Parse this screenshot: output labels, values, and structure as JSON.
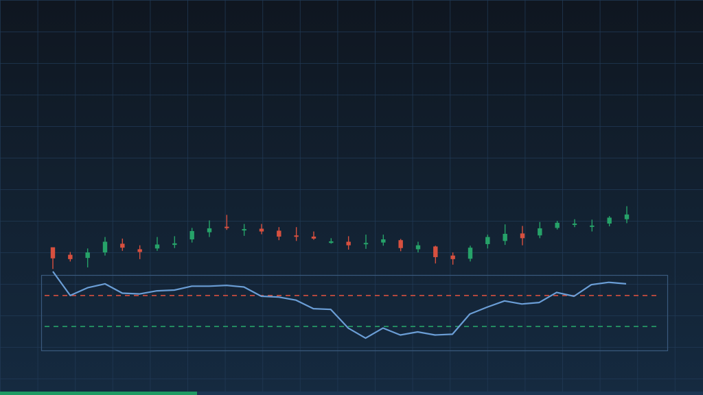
{
  "chart_data": [
    {
      "type": "candlestick",
      "grid": true,
      "up_color": "#26a269",
      "down_color": "#d7503f",
      "ylim": [
        0,
        100
      ],
      "candles": [
        {
          "open": 37.4,
          "close": 34.6,
          "high": 36.1,
          "low": 31.9
        },
        {
          "open": 35.5,
          "close": 34.4,
          "high": 36.2,
          "low": 33.8
        },
        {
          "open": 34.7,
          "close": 36.1,
          "high": 37.1,
          "low": 32.3
        },
        {
          "open": 36.1,
          "close": 38.8,
          "high": 40.0,
          "low": 35.3
        },
        {
          "open": 38.3,
          "close": 37.3,
          "high": 39.6,
          "low": 36.5
        },
        {
          "open": 36.9,
          "close": 36.2,
          "high": 37.9,
          "low": 34.4
        },
        {
          "open": 37.1,
          "close": 38.1,
          "high": 40.0,
          "low": 36.5
        },
        {
          "open": 38.0,
          "close": 38.4,
          "high": 40.2,
          "low": 37.2
        },
        {
          "open": 39.4,
          "close": 41.5,
          "high": 42.3,
          "low": 38.6
        },
        {
          "open": 41.2,
          "close": 42.2,
          "high": 44.2,
          "low": 40.0
        },
        {
          "open": 42.6,
          "close": 42.5,
          "high": 45.6,
          "low": 41.8
        },
        {
          "open": 42.0,
          "close": 42.0,
          "high": 43.3,
          "low": 40.3
        },
        {
          "open": 42.1,
          "close": 41.4,
          "high": 43.3,
          "low": 40.7
        },
        {
          "open": 41.6,
          "close": 40.1,
          "high": 42.5,
          "low": 39.2
        },
        {
          "open": 40.4,
          "close": 40.2,
          "high": 42.5,
          "low": 39.0
        },
        {
          "open": 40.1,
          "close": 39.6,
          "high": 41.4,
          "low": 39.3
        },
        {
          "open": 38.5,
          "close": 38.9,
          "high": 39.7,
          "low": 38.3
        },
        {
          "open": 38.8,
          "close": 37.9,
          "high": 40.2,
          "low": 36.8
        },
        {
          "open": 38.2,
          "close": 38.5,
          "high": 40.6,
          "low": 37.0
        },
        {
          "open": 38.6,
          "close": 39.4,
          "high": 40.6,
          "low": 37.8
        },
        {
          "open": 39.2,
          "close": 37.2,
          "high": 39.5,
          "low": 36.4
        },
        {
          "open": 36.9,
          "close": 37.9,
          "high": 38.8,
          "low": 36.1
        },
        {
          "open": 37.6,
          "close": 34.9,
          "high": 37.8,
          "low": 33.3
        },
        {
          "open": 35.3,
          "close": 34.4,
          "high": 36.1,
          "low": 33.0
        },
        {
          "open": 34.5,
          "close": 37.3,
          "high": 37.8,
          "low": 33.8
        },
        {
          "open": 38.2,
          "close": 40.0,
          "high": 40.6,
          "low": 37.1
        },
        {
          "open": 39.0,
          "close": 40.8,
          "high": 43.2,
          "low": 38.0
        },
        {
          "open": 40.9,
          "close": 39.7,
          "high": 42.8,
          "low": 37.9
        },
        {
          "open": 40.4,
          "close": 42.2,
          "high": 43.8,
          "low": 39.7
        },
        {
          "open": 42.3,
          "close": 43.6,
          "high": 44.1,
          "low": 41.9
        },
        {
          "open": 43.3,
          "close": 43.4,
          "high": 44.5,
          "low": 42.5
        },
        {
          "open": 42.8,
          "close": 42.9,
          "high": 44.4,
          "low": 41.4
        },
        {
          "open": 43.4,
          "close": 44.9,
          "high": 45.3,
          "low": 42.7
        },
        {
          "open": 44.5,
          "close": 45.7,
          "high": 47.8,
          "low": 43.5
        }
      ]
    },
    {
      "type": "line",
      "grid": true,
      "ylim": [
        0,
        100
      ],
      "line_color": "#6b9ed6",
      "values": [
        101,
        70,
        80,
        85,
        73,
        72,
        76,
        77,
        82,
        82,
        83,
        81,
        69,
        68,
        64,
        53,
        52,
        28,
        15,
        28,
        19,
        23,
        19,
        20,
        46,
        55,
        63,
        59,
        61,
        74,
        69,
        84,
        87,
        85
      ],
      "reference_lines": [
        {
          "value": 70,
          "color": "#d7503f"
        },
        {
          "value": 30,
          "color": "#26a269"
        }
      ]
    }
  ],
  "progress": {
    "fraction": 0.28,
    "fill_color": "#1f9a63"
  }
}
